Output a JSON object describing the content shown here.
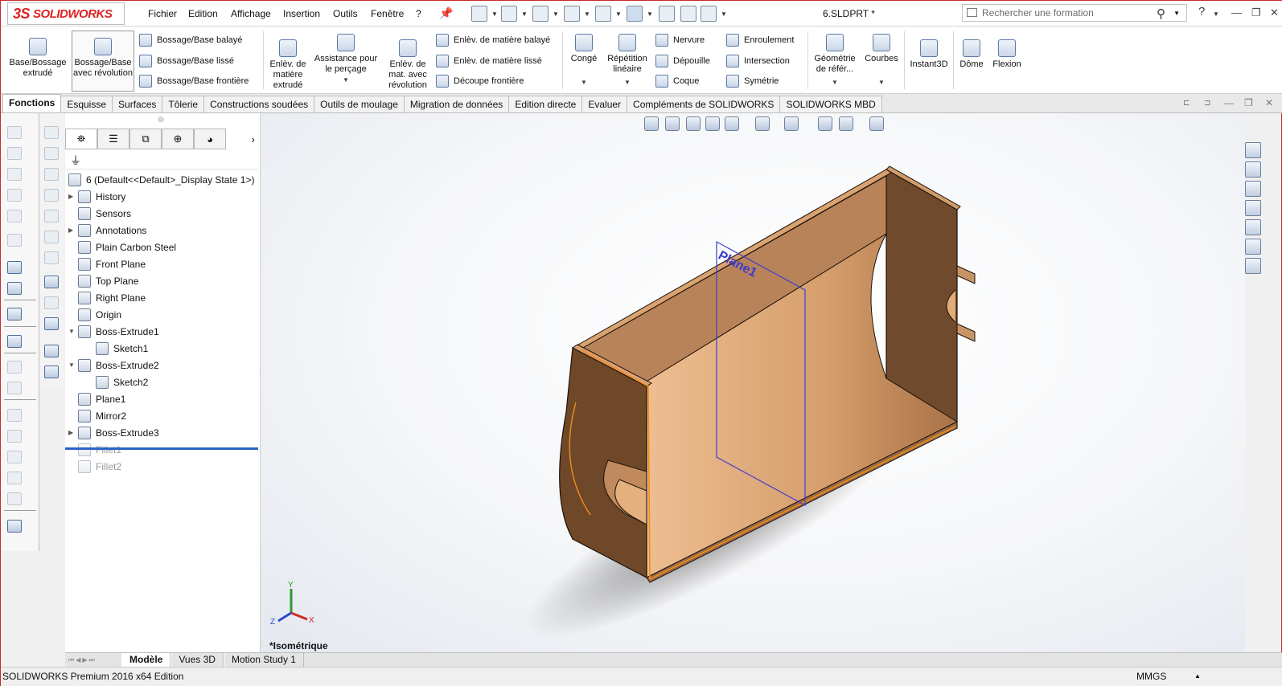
{
  "app": {
    "logo_text": "SOLIDWORKS",
    "logo_prefix": "3S",
    "document_title": "6.SLDPRT *"
  },
  "menu": [
    "Fichier",
    "Edition",
    "Affichage",
    "Insertion",
    "Outils",
    "Fenêtre",
    "?"
  ],
  "search": {
    "placeholder": "Rechercher une formation"
  },
  "help_label": "?",
  "ribbon": {
    "base_extrude": "Base/Bossage extrudé",
    "revolve": "Bossage/Base avec révolution",
    "swept": "Bossage/Base balayé",
    "lofted": "Bossage/Base lissé",
    "boundary": "Bossage/Base frontière",
    "cut_extrude": "Enlèv. de matière extrudé",
    "hole_wizard": "Assistance pour le perçage",
    "cut_revolve": "Enlèv. de mat. avec révolution",
    "cut_swept": "Enlèv. de matière balayé",
    "cut_loft": "Enlèv. de matière lissé",
    "boundary_cut": "Découpe frontière",
    "fillet": "Congé",
    "linear_pattern": "Répétition linéaire",
    "rib": "Nervure",
    "draft": "Dépouille",
    "shell": "Coque",
    "wrap": "Enroulement",
    "intersect": "Intersection",
    "mirror": "Symétrie",
    "ref_geometry": "Géométrie de référ...",
    "curves": "Courbes",
    "instant3d": "Instant3D",
    "dome": "Dôme",
    "flex": "Flexion"
  },
  "tabs": [
    "Fonctions",
    "Esquisse",
    "Surfaces",
    "Tôlerie",
    "Constructions soudées",
    "Outils de moulage",
    "Migration de données",
    "Edition directe",
    "Evaluer",
    "Compléments de SOLIDWORKS",
    "SOLIDWORKS MBD"
  ],
  "feature_tree": {
    "root": "6  (Default<<Default>_Display State 1>)",
    "items": [
      {
        "label": "History",
        "expander": "▶",
        "indent": 0,
        "dim": false
      },
      {
        "label": "Sensors",
        "expander": "",
        "indent": 0,
        "dim": false
      },
      {
        "label": "Annotations",
        "expander": "▶",
        "indent": 0,
        "dim": false
      },
      {
        "label": "Plain Carbon Steel",
        "expander": "",
        "indent": 0,
        "dim": false
      },
      {
        "label": "Front Plane",
        "expander": "",
        "indent": 0,
        "dim": false
      },
      {
        "label": "Top Plane",
        "expander": "",
        "indent": 0,
        "dim": false
      },
      {
        "label": "Right Plane",
        "expander": "",
        "indent": 0,
        "dim": false
      },
      {
        "label": "Origin",
        "expander": "",
        "indent": 0,
        "dim": false
      },
      {
        "label": "Boss-Extrude1",
        "expander": "▼",
        "indent": 0,
        "dim": false
      },
      {
        "label": "Sketch1",
        "expander": "",
        "indent": 1,
        "dim": false
      },
      {
        "label": "Boss-Extrude2",
        "expander": "▼",
        "indent": 0,
        "dim": false
      },
      {
        "label": "Sketch2",
        "expander": "",
        "indent": 1,
        "dim": false
      },
      {
        "label": "Plane1",
        "expander": "",
        "indent": 0,
        "dim": false
      },
      {
        "label": "Mirror2",
        "expander": "",
        "indent": 0,
        "dim": false
      },
      {
        "label": "Boss-Extrude3",
        "expander": "▶",
        "indent": 0,
        "dim": false
      },
      {
        "label": "Fillet1",
        "expander": "",
        "indent": 0,
        "dim": true
      },
      {
        "label": "Fillet2",
        "expander": "",
        "indent": 0,
        "dim": true
      }
    ]
  },
  "viewport": {
    "plane_label": "Plane1",
    "view_name": "*Isométrique",
    "triad": {
      "x": "X",
      "y": "Y",
      "z": "Z"
    }
  },
  "bottom_tabs": [
    "Modèle",
    "Vues 3D",
    "Motion Study 1"
  ],
  "status": {
    "left": "SOLIDWORKS Premium 2016 x64 Edition",
    "units": "MMGS"
  },
  "colors": {
    "part": "#c58c5c",
    "plane_edge": "#3c3ccf",
    "selection": "#f08c1e",
    "accent": "#c82a2a"
  }
}
